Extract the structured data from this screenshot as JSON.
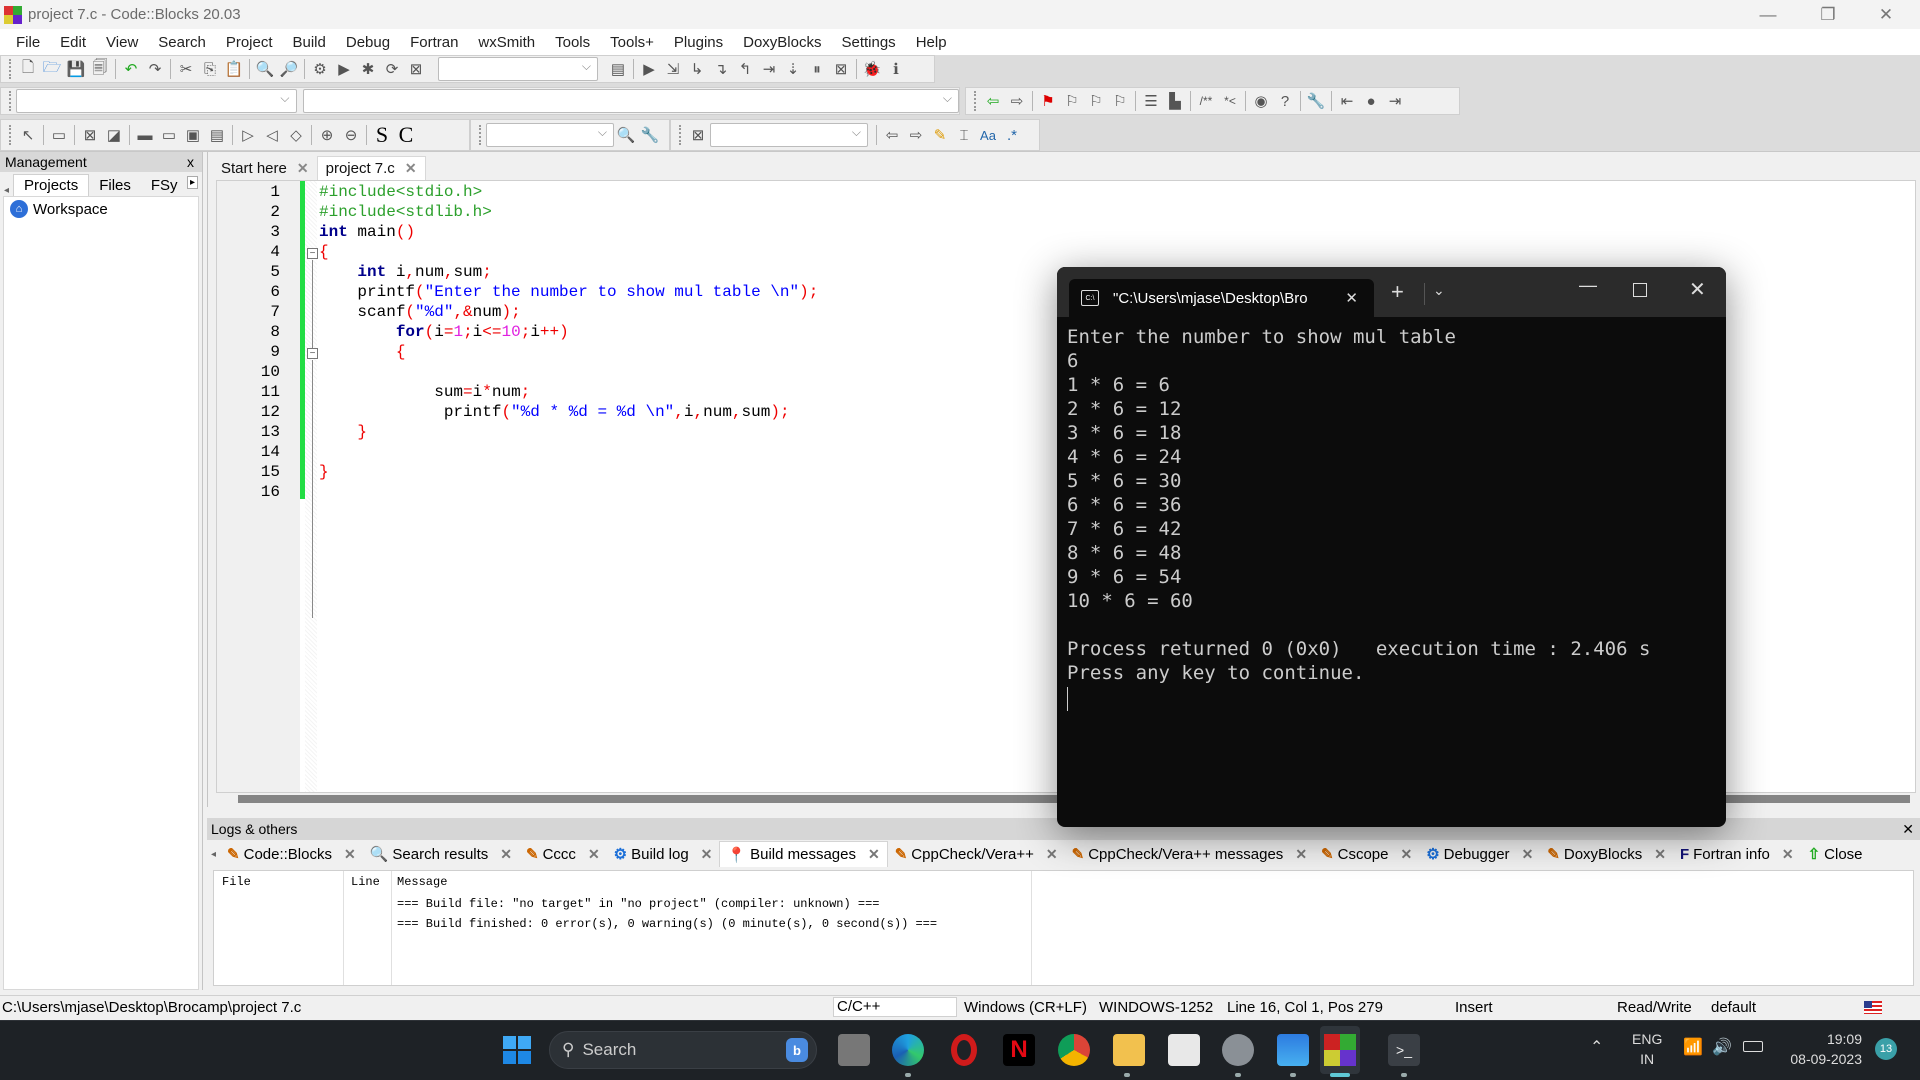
{
  "window": {
    "title": "project 7.c - Code::Blocks 20.03"
  },
  "menu": [
    "File",
    "Edit",
    "View",
    "Search",
    "Project",
    "Build",
    "Debug",
    "Fortran",
    "wxSmith",
    "Tools",
    "Tools+",
    "Plugins",
    "DoxyBlocks",
    "Settings",
    "Help"
  ],
  "management": {
    "title": "Management",
    "close": "x",
    "tabs": [
      "Projects",
      "Files",
      "FSy"
    ],
    "tree": [
      {
        "icon": "workspace-icon",
        "label": "Workspace"
      }
    ]
  },
  "editor": {
    "tabs": [
      {
        "label": "Start here",
        "active": false
      },
      {
        "label": "project 7.c",
        "active": true
      }
    ],
    "line_numbers": [
      "1",
      "2",
      "3",
      "4",
      "5",
      "6",
      "7",
      "8",
      "9",
      "10",
      "11",
      "12",
      "13",
      "14",
      "15",
      "16"
    ],
    "lines": [
      "#include<stdio.h>",
      "#include<stdlib.h>",
      "int main()",
      "{",
      "    int i,num,sum;",
      "    printf(\"Enter the number to show mul table \\n\");",
      "    scanf(\"%d\",&num);",
      "        for(i=1;i<=10;i++)",
      "        {",
      "",
      "            sum=i*num;",
      "             printf(\"%d * %d = %d \\n\",i,num,sum);",
      "    }",
      "",
      "}",
      ""
    ]
  },
  "logs": {
    "title": "Logs & others",
    "tabs": [
      {
        "icon": "pencil-icon",
        "label": "Code::Blocks"
      },
      {
        "icon": "search-icon",
        "label": "Search results"
      },
      {
        "icon": "pencil-icon",
        "label": "Cccc"
      },
      {
        "icon": "gear-icon",
        "label": "Build log"
      },
      {
        "icon": "pin-icon",
        "label": "Build messages",
        "active": true
      },
      {
        "icon": "pencil-icon",
        "label": "CppCheck/Vera++"
      },
      {
        "icon": "pencil-icon",
        "label": "CppCheck/Vera++ messages"
      },
      {
        "icon": "pencil-icon",
        "label": "Cscope"
      },
      {
        "icon": "gear-icon",
        "label": "Debugger"
      },
      {
        "icon": "pencil-icon",
        "label": "DoxyBlocks"
      },
      {
        "icon": "fortran-icon",
        "label": "Fortran info"
      },
      {
        "icon": "arrow-up-icon",
        "label": "Close"
      }
    ],
    "columns": [
      "File",
      "Line",
      "Message"
    ],
    "rows": [
      {
        "file": "",
        "line": "",
        "message": "=== Build file: \"no target\" in \"no project\" (compiler: unknown) ==="
      },
      {
        "file": "",
        "line": "",
        "message": "=== Build finished: 0 error(s), 0 warning(s) (0 minute(s), 0 second(s)) ==="
      }
    ]
  },
  "statusbar": {
    "path": "C:\\Users\\mjase\\Desktop\\Brocamp\\project 7.c",
    "language": "C/C++",
    "eol": "Windows (CR+LF)",
    "encoding": "WINDOWS-1252",
    "position": "Line 16, Col 1, Pos 279",
    "mode": "Insert",
    "access": "Read/Write",
    "profile": "default"
  },
  "terminal": {
    "tab_title": "\"C:\\Users\\mjase\\Desktop\\Bro",
    "output": [
      "Enter the number to show mul table",
      "6",
      "1 * 6 = 6",
      "2 * 6 = 12",
      "3 * 6 = 18",
      "4 * 6 = 24",
      "5 * 6 = 30",
      "6 * 6 = 36",
      "7 * 6 = 42",
      "8 * 6 = 48",
      "9 * 6 = 54",
      "10 * 6 = 60",
      "",
      "Process returned 0 (0x0)   execution time : 2.406 s",
      "Press any key to continue."
    ]
  },
  "taskbar": {
    "search_placeholder": "Search",
    "apps": [
      "task-view",
      "edge",
      "opera",
      "netflix",
      "chrome",
      "file-explorer",
      "ms-store",
      "settings",
      "photos",
      "codeblocks",
      "terminal"
    ],
    "tray": {
      "lang1": "ENG",
      "lang2": "IN",
      "time": "19:09",
      "date": "08-09-2023",
      "notifications": "13"
    }
  }
}
